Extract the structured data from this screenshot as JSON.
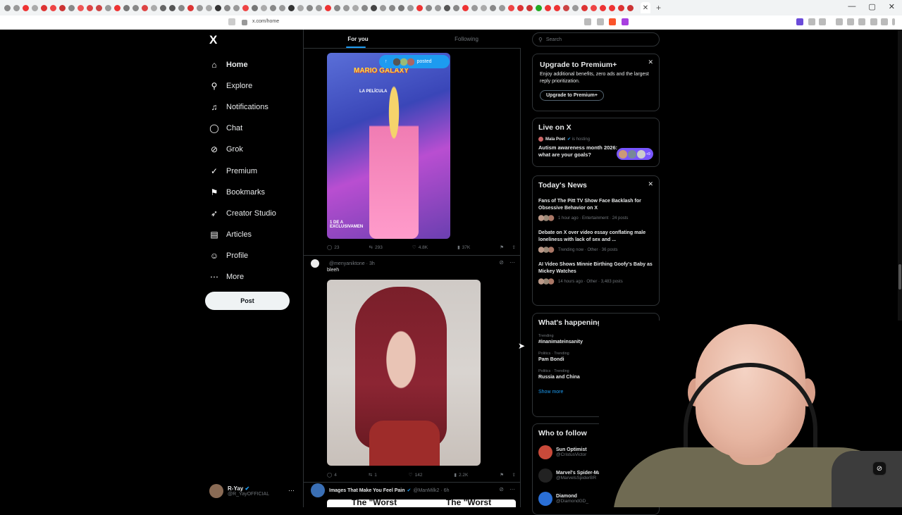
{
  "browser": {
    "url": "x.com/home",
    "tab_favicon_colors": [
      "#888",
      "#999",
      "#e33",
      "#aaa",
      "#d33",
      "#e44",
      "#c33",
      "#888",
      "#e55",
      "#d44",
      "#c44",
      "#999",
      "#e33",
      "#777",
      "#888",
      "#d44",
      "#aaa",
      "#666",
      "#555",
      "#888",
      "#d33",
      "#999",
      "#aaa",
      "#333",
      "#888",
      "#999",
      "#e44",
      "#777",
      "#aaa",
      "#888",
      "#999",
      "#333",
      "#aaa",
      "#888",
      "#999",
      "#e33",
      "#888",
      "#999",
      "#aaa",
      "#888",
      "#444",
      "#999",
      "#888",
      "#777",
      "#999",
      "#e33",
      "#888",
      "#999",
      "#555",
      "#888",
      "#e33",
      "#999",
      "#aaa",
      "#888",
      "#999",
      "#e44",
      "#d33",
      "#c33",
      "#2a2",
      "#e33",
      "#e33",
      "#c44",
      "#999",
      "#d33",
      "#e44",
      "#e33",
      "#e33",
      "#d33",
      "#c33"
    ]
  },
  "sidebar": {
    "logo": "X",
    "items": [
      {
        "label": "Home",
        "icon": "home-icon",
        "glyph": "⌂"
      },
      {
        "label": "Explore",
        "icon": "search-icon",
        "glyph": "⚲"
      },
      {
        "label": "Notifications",
        "icon": "bell-icon",
        "glyph": "♫"
      },
      {
        "label": "Chat",
        "icon": "chat-bubble-icon",
        "glyph": "◯"
      },
      {
        "label": "Grok",
        "icon": "grok-icon",
        "glyph": "⊘"
      },
      {
        "label": "Premium",
        "icon": "premium-badge-icon",
        "glyph": "✓"
      },
      {
        "label": "Bookmarks",
        "icon": "bookmark-icon",
        "glyph": "⚑"
      },
      {
        "label": "Creator Studio",
        "icon": "rocket-icon",
        "glyph": "➶"
      },
      {
        "label": "Articles",
        "icon": "article-icon",
        "glyph": "▤"
      },
      {
        "label": "Profile",
        "icon": "profile-icon",
        "glyph": "☺"
      },
      {
        "label": "More",
        "icon": "more-circle-icon",
        "glyph": "⋯"
      }
    ],
    "post_label": "Post",
    "account": {
      "name": "R-Yay",
      "handle": "@R_YayOFFICIAL"
    }
  },
  "feed": {
    "tabs": [
      "For you",
      "Following"
    ],
    "posted_pill": "posted",
    "tweet1": {
      "image_title": "MARIO GALAXY",
      "image_subtitle": "LA PELÍCULA",
      "image_side_text": "1 DE A\nEXCLUSIVAMEN",
      "replies": "23",
      "reposts": "293",
      "likes": "4.8K",
      "views": "37K"
    },
    "tweet2": {
      "handle": "@menyaniktone",
      "time": "3h",
      "text": "bleeh",
      "replies": "4",
      "reposts": "1",
      "likes": "142",
      "views": "2.2K"
    },
    "tweet3": {
      "name": "Images That Make You Feel Pain",
      "handle": "@ManMilk2",
      "time": "6h",
      "image_text_left": "The \"Worst",
      "image_text_right": "The \"Worst"
    }
  },
  "right": {
    "search_placeholder": "Search",
    "premium": {
      "title": "Upgrade to Premium+",
      "body": "Enjoy additional benefits, zero ads and the largest reply prioritization.",
      "button": "Upgrade to Premium+"
    },
    "live": {
      "title": "Live on X",
      "host": "Mala Poet",
      "hosting": "is hosting",
      "space_title": "Autism awareness month 2026: what are your goals?",
      "extra": "+9"
    },
    "news": {
      "title": "Today's News",
      "items": [
        {
          "title": "Fans of The Pitt TV Show Face Backlash for Obsessive Behavior on X",
          "meta": "1 hour ago · Entertainment · 24 posts"
        },
        {
          "title": "Debate on X over video essay conflating male loneliness with lack of sex and ...",
          "meta": "Trending now · Other · 36 posts"
        },
        {
          "title": "AI Video Shows Minnie Birthing Goofy's Baby as Mickey Watches",
          "meta": "14 hours ago · Other · 3,483 posts"
        }
      ]
    },
    "happening": {
      "title": "What's happening",
      "trends": [
        {
          "context": "Trending",
          "name": "#inanimateinsanity"
        },
        {
          "context": "Politics · Trending",
          "name": "Pam Bondi"
        },
        {
          "context": "Politics · Trending",
          "name": "Russia and China"
        }
      ],
      "show_more": "Show more"
    },
    "follow": {
      "title": "Who to follow",
      "users": [
        {
          "name": "Sun Optimist",
          "handle": "@CristusVictor",
          "color": "#c94a3a"
        },
        {
          "name": "Marvel's Spider-Man ...",
          "handle": "@MarvelsSpiderBR",
          "color": "#222"
        },
        {
          "name": "Diamond",
          "handle": "@DiamondGD_",
          "color": "#2a6fd6"
        }
      ],
      "follow_label": "Follow"
    }
  },
  "colors": {
    "accent": "#1d9bf0",
    "background": "#000000",
    "border": "#2f3336",
    "muted": "#71767b"
  }
}
